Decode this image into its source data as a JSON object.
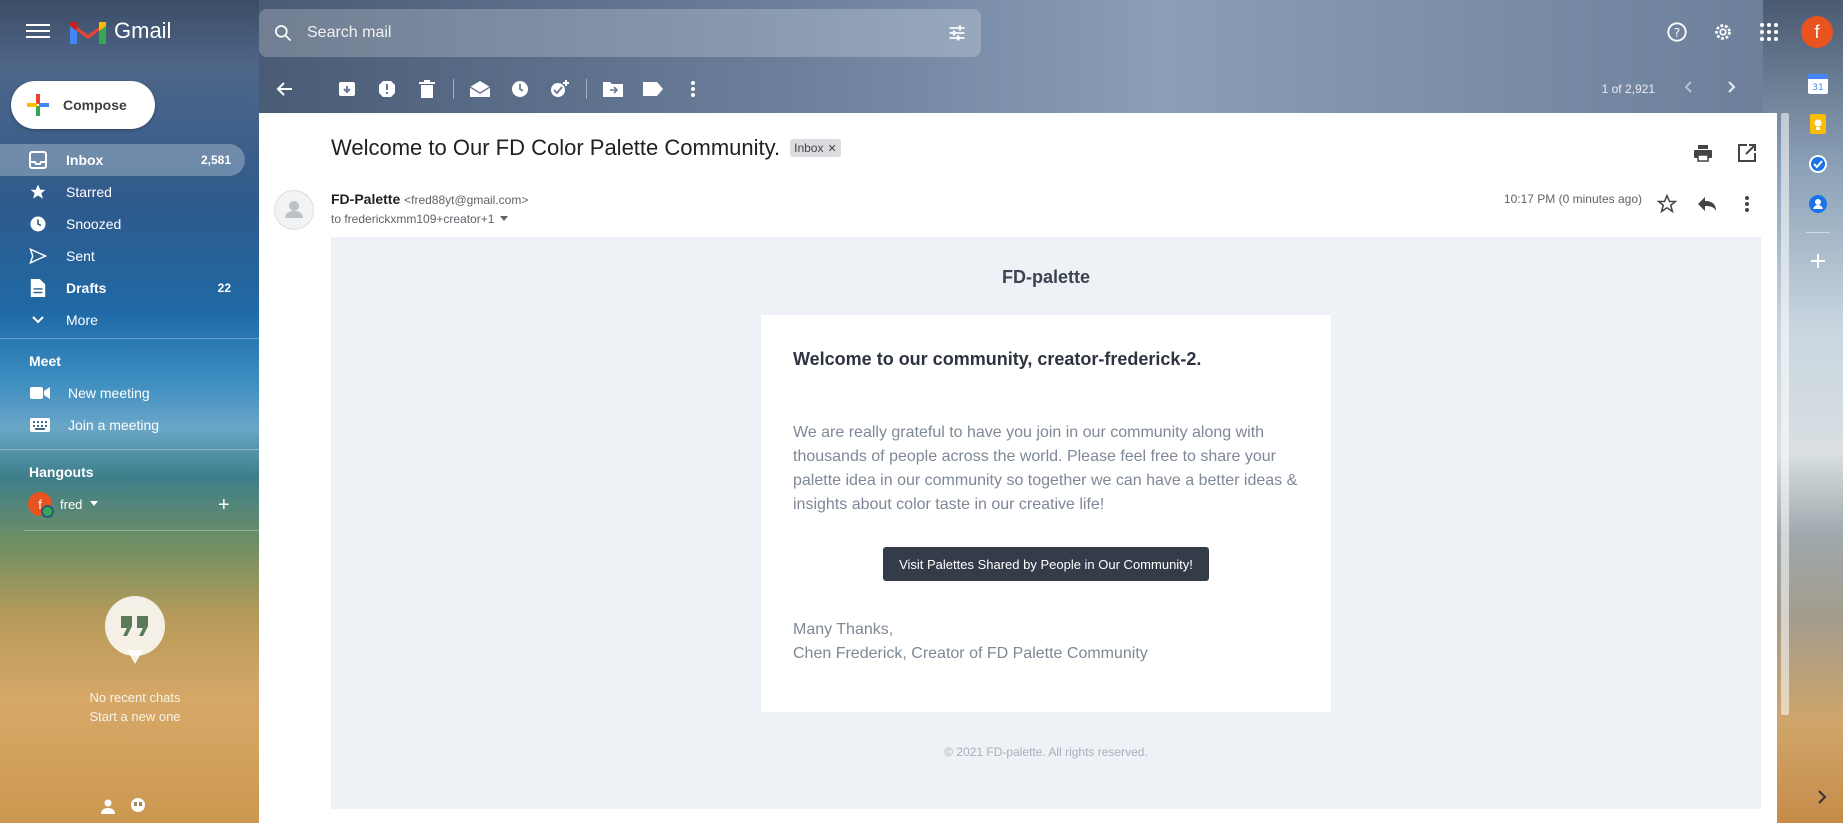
{
  "app": {
    "name": "Gmail"
  },
  "search": {
    "placeholder": "Search mail"
  },
  "user": {
    "initial": "f"
  },
  "sidebar": {
    "compose": "Compose",
    "items": [
      {
        "label": "Inbox",
        "count": "2,581",
        "icon": "inbox-icon",
        "active": true
      },
      {
        "label": "Starred",
        "count": "",
        "icon": "star-icon"
      },
      {
        "label": "Snoozed",
        "count": "",
        "icon": "clock-icon"
      },
      {
        "label": "Sent",
        "count": "",
        "icon": "send-icon"
      },
      {
        "label": "Drafts",
        "count": "22",
        "icon": "draft-icon"
      },
      {
        "label": "More",
        "count": "",
        "icon": "chevron-down-icon"
      }
    ],
    "meet": {
      "title": "Meet",
      "new_meeting": "New meeting",
      "join_meeting": "Join a meeting"
    },
    "hangouts": {
      "title": "Hangouts",
      "user": "fred",
      "user_initial": "f",
      "no_chats": "No recent chats",
      "start_new": "Start a new one"
    }
  },
  "toolbar": {
    "pager": "1 of 2,921"
  },
  "email": {
    "subject": "Welcome to Our FD Color Palette Community.",
    "label": "Inbox",
    "sender_name": "FD-Palette",
    "sender_email": "<fred88yt@gmail.com>",
    "recipient": "to frederickxmm109+creator+1",
    "time": "10:17 PM (0 minutes ago)",
    "body": {
      "brand": "FD-palette",
      "heading": "Welcome to our community, creator-frederick-2.",
      "intro": "We are really grateful to have you join in our community along with thousands of people across the world. Please feel free to share your palette idea in our community so together we can have a better ideas & insights about color taste in our creative life!",
      "cta": "Visit Palettes Shared by People in Our Community!",
      "thanks": "Many Thanks,",
      "signature": "Chen Frederick, Creator of FD Palette Community",
      "footer": "© 2021 FD-palette. All rights reserved."
    }
  },
  "colors": {
    "accent": "#e8531f",
    "cta": "#343c4a",
    "body_bg": "#eef1f5"
  }
}
